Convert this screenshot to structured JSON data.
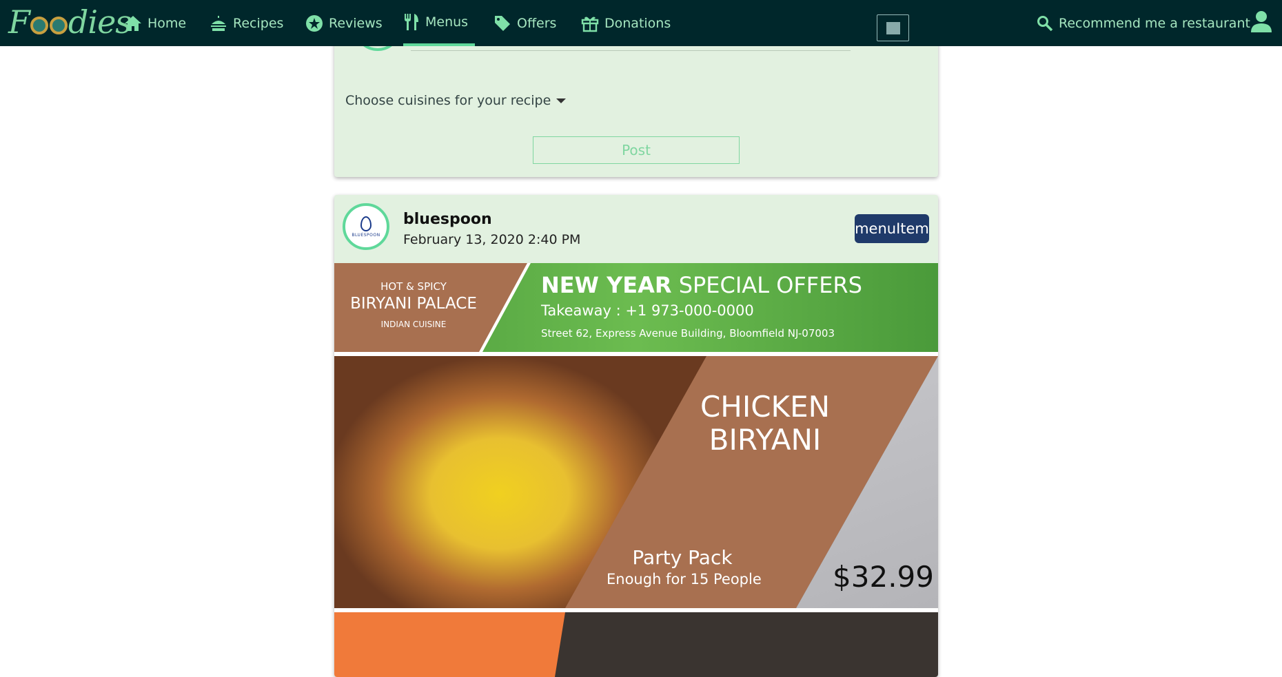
{
  "nav": {
    "brand": "Foodies",
    "items": [
      {
        "label": "Home",
        "icon": "home-icon"
      },
      {
        "label": "Recipes",
        "icon": "recipes-icon"
      },
      {
        "label": "Reviews",
        "icon": "star-icon"
      },
      {
        "label": "Menus",
        "icon": "utensils-icon",
        "active": true
      },
      {
        "label": "Offers",
        "icon": "tag-icon"
      },
      {
        "label": "Donations",
        "icon": "gift-icon"
      }
    ],
    "image_button_icon": "image-icon",
    "recommend_label": "Recommend me a restaurant",
    "user_icon": "user-icon"
  },
  "compose": {
    "cuisine_dropdown": "Choose cuisines for your recipe",
    "post_label": "Post"
  },
  "post": {
    "username": "bluespoon",
    "avatar_brand": "BLUESPOON",
    "date": "February 13, 2020 2:40 PM",
    "tag": "menuItem",
    "menu": {
      "hot_spicy": "HOT & SPICY",
      "restaurant": "BIRYANI PALACE",
      "cuisine": "INDIAN CUISINE",
      "headline_bold": "NEW YEAR",
      "headline_rest": " SPECIAL OFFERS",
      "takeaway": "Takeaway :  +1 973-000-0000",
      "address": "Street 62, Express Avenue Building, Bloomfield NJ-07003",
      "dish_line1": "CHICKEN",
      "dish_line2": "BIRYANI",
      "pack": "Party Pack",
      "serves": "Enough for 15 People",
      "price": "$32.99"
    }
  },
  "colors": {
    "navbar": "#00272b",
    "accent": "#5fd89a",
    "card": "#e2f1e0",
    "tag_button": "#1f3a6a"
  }
}
